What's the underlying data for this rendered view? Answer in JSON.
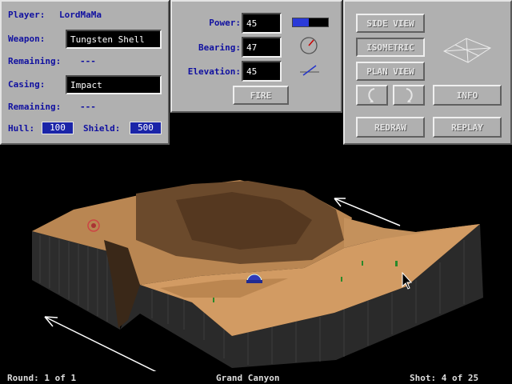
{
  "player": {
    "label": "Player:",
    "name": "LordMaMa"
  },
  "weapon": {
    "label": "Weapon:",
    "value": "Tungsten Shell",
    "remaining_label": "Remaining:",
    "remaining_value": "---"
  },
  "casing": {
    "label": "Casing:",
    "value": "Impact",
    "remaining_label": "Remaining:",
    "remaining_value": "---"
  },
  "hull": {
    "label": "Hull:",
    "value": "100"
  },
  "shield": {
    "label": "Shield:",
    "value": "500"
  },
  "controls": {
    "power_label": "Power:",
    "power_value": "45",
    "power_fraction": 0.45,
    "bearing_label": "Bearing:",
    "bearing_value": "47",
    "elevation_label": "Elevation:",
    "elevation_value": "45",
    "fire_label": "FIRE"
  },
  "view": {
    "side_view": "SIDE VIEW",
    "isometric": "ISOMETRIC",
    "plan_view": "PLAN VIEW",
    "info": "INFO",
    "redraw": "REDRAW",
    "replay": "REPLAY",
    "rotate_left_icon": "rotate-ccw-icon",
    "rotate_right_icon": "rotate-cw-icon"
  },
  "status": {
    "round": "Round: 1 of 1",
    "map_name": "Grand Canyon",
    "shot": "Shot: 4 of 25"
  },
  "colors": {
    "panel": "#b0b0b0",
    "label": "#1010a0",
    "terrain_top": "#c8955f",
    "terrain_shadow": "#6a4a2c",
    "cliff": "#303030"
  }
}
